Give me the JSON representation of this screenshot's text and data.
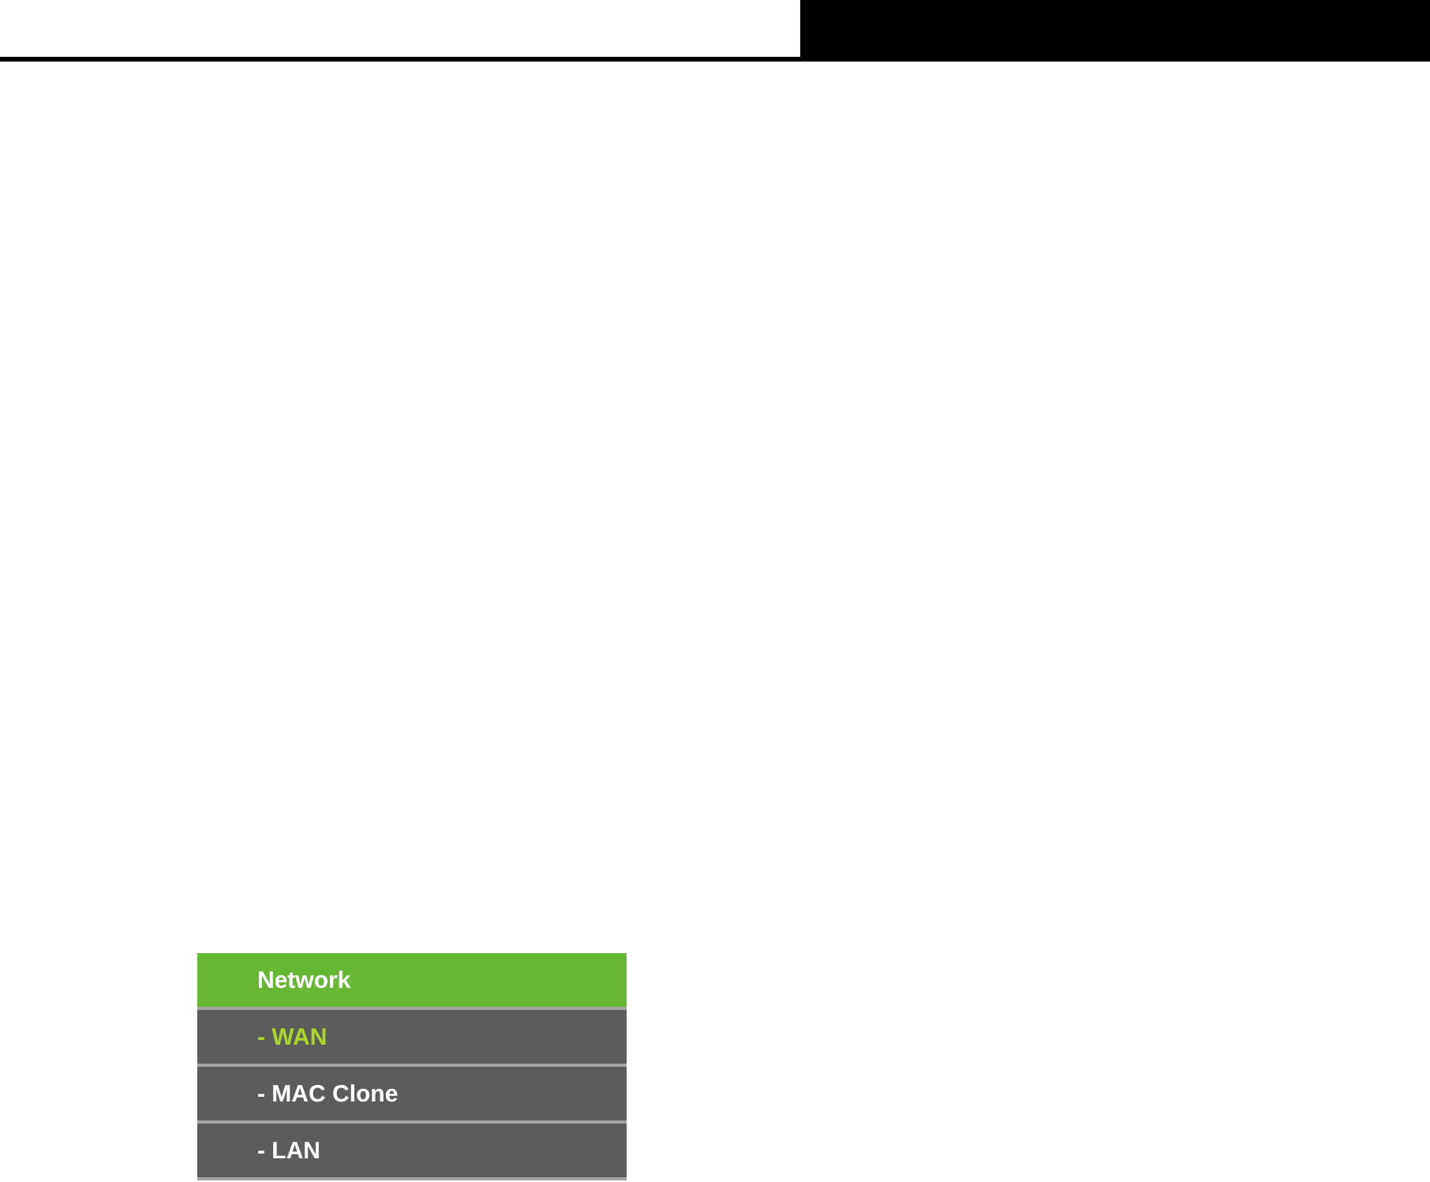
{
  "menu": {
    "title": "Network",
    "items": [
      {
        "label": "- WAN",
        "selected": true
      },
      {
        "label": "- MAC Clone",
        "selected": false
      },
      {
        "label": "- LAN",
        "selected": false
      }
    ]
  }
}
